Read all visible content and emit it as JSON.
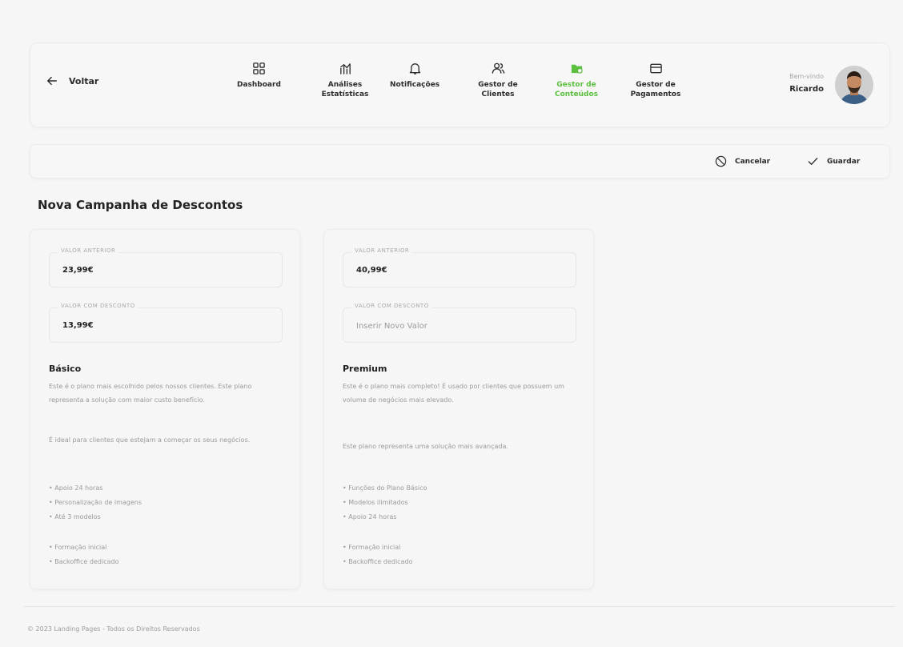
{
  "nav": {
    "back_label": "Voltar",
    "items": [
      {
        "label": "Dashboard",
        "icon": "dashboard-icon"
      },
      {
        "label": "Análises Estatísticas",
        "icon": "chart-icon"
      },
      {
        "label": "Notificações",
        "icon": "bell-icon"
      },
      {
        "label": "Gestor de Clientes",
        "icon": "users-icon"
      },
      {
        "label": "Gestor de Conteúdos",
        "icon": "folder-icon",
        "active": true
      },
      {
        "label": "Gestor de Pagamentos",
        "icon": "card-icon"
      }
    ],
    "active_color": "#5bbf3f"
  },
  "user": {
    "greeting": "Bem-vindo",
    "name": "Ricardo"
  },
  "actions": {
    "cancel_label": "Cancelar",
    "save_label": "Guardar"
  },
  "page": {
    "title": "Nova Campanha de Descontos"
  },
  "plans": [
    {
      "previous_label": "VALOR ANTERIOR",
      "previous_value": "23,99€",
      "discount_label": "VALOR COM DESCONTO",
      "discount_value": "13,99€",
      "name": "Básico",
      "desc1": "Este é o plano mais escolhido pelos nossos clientes. Este plano representa a solução com maior custo benefício.",
      "desc2": "É ideal para clientes que estejam a começar os seus negócios.",
      "features1": [
        "Apoio 24 horas",
        "Personalização de imagens",
        "Até 3 modelos"
      ],
      "features2": [
        "Formação inicial",
        "Backoffice dedicado"
      ]
    },
    {
      "previous_label": "VALOR ANTERIOR",
      "previous_value": "40,99€",
      "discount_label": "VALOR COM DESCONTO",
      "discount_placeholder": "Inserir Novo Valor",
      "name": "Premium",
      "desc1": "Este é o plano mais completo! É usado por clientes que possuem um volume de negócios mais elevado.",
      "desc2": "Este plano representa uma solução mais avançada.",
      "features1": [
        "Funções do Plano Básico",
        "Modelos ilimitados",
        "Apoio 24 horas"
      ],
      "features2": [
        "Formação inicial",
        "Backoffice dedicado"
      ]
    }
  ],
  "footer": {
    "text": "© 2023 Landing Pages - Todos os Direitos Reservados"
  }
}
